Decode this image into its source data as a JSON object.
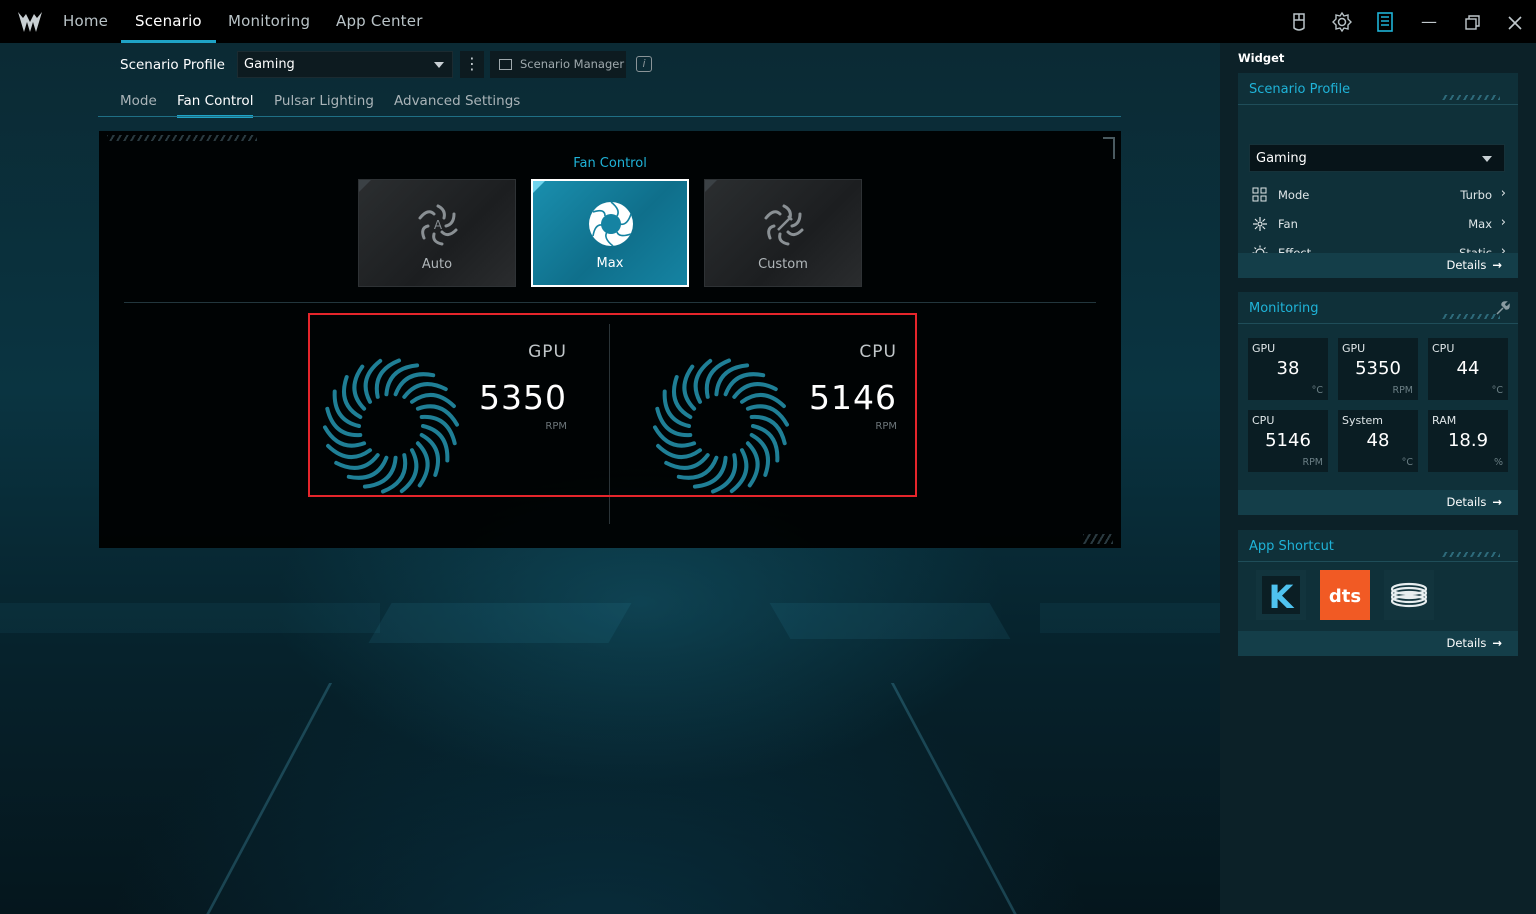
{
  "topnav": {
    "tabs": [
      {
        "label": "Home"
      },
      {
        "label": "Scenario"
      },
      {
        "label": "Monitoring"
      },
      {
        "label": "App Center"
      }
    ],
    "active_tab": "Scenario"
  },
  "scenario": {
    "profile_label": "Scenario Profile",
    "profile_value": "Gaming",
    "scenario_manager_label": "Scenario Manager",
    "info_icon": "i",
    "subtabs": [
      {
        "label": "Mode"
      },
      {
        "label": "Fan Control"
      },
      {
        "label": "Pulsar Lighting"
      },
      {
        "label": "Advanced Settings"
      }
    ],
    "active_subtab": "Fan Control"
  },
  "fan_control": {
    "title": "Fan Control",
    "modes": [
      {
        "label": "Auto"
      },
      {
        "label": "Max"
      },
      {
        "label": "Custom"
      }
    ],
    "selected_mode": "Max",
    "gpu": {
      "name": "GPU",
      "value": "5350",
      "unit": "RPM"
    },
    "cpu": {
      "name": "CPU",
      "value": "5146",
      "unit": "RPM"
    }
  },
  "widget": {
    "title": "Widget",
    "scenario_profile": {
      "header": "Scenario Profile",
      "selected": "Gaming",
      "rows": [
        {
          "label": "Mode",
          "value": "Turbo",
          "icon": "grid-icon"
        },
        {
          "label": "Fan",
          "value": "Max",
          "icon": "fan-icon"
        },
        {
          "label": "Effect",
          "value": "Static",
          "icon": "sun-icon"
        }
      ],
      "details": "Details"
    },
    "monitoring": {
      "header": "Monitoring",
      "tiles": [
        {
          "name": "GPU",
          "value": "38",
          "unit": "°C"
        },
        {
          "name": "GPU",
          "value": "5350",
          "unit": "RPM"
        },
        {
          "name": "CPU",
          "value": "44",
          "unit": "°C"
        },
        {
          "name": "CPU",
          "value": "5146",
          "unit": "RPM"
        },
        {
          "name": "System",
          "value": "48",
          "unit": "°C"
        },
        {
          "name": "RAM",
          "value": "18.9",
          "unit": "%"
        }
      ],
      "details": "Details"
    },
    "app_shortcut": {
      "header": "App Shortcut",
      "apps": [
        {
          "name": "k-app-icon",
          "glyph": "K"
        },
        {
          "name": "dts-app-icon",
          "glyph": "dts"
        },
        {
          "name": "coil-app-icon",
          "glyph": ""
        }
      ],
      "details": "Details"
    }
  },
  "colors": {
    "accent": "#1fb3d8",
    "highlight_box": "#e5252b",
    "active_mode": "#1583a2"
  }
}
